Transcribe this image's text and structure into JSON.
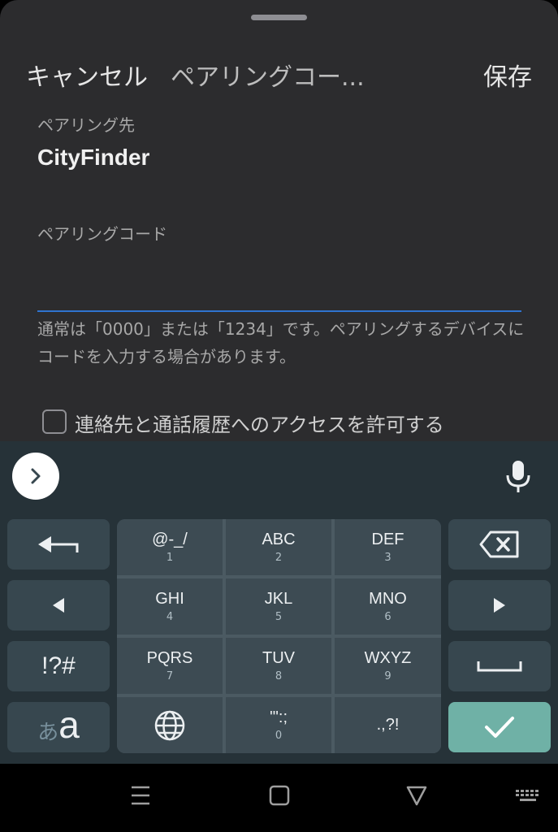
{
  "dialog": {
    "cancel_label": "キャンセル",
    "title": "ペアリングコー...",
    "save_label": "保存",
    "target_label": "ペアリング先",
    "target_value": "CityFinder",
    "code_label": "ペアリングコード",
    "code_value": "",
    "help_text": "通常は「0000」または「1234」です。ペアリングするデバイスにコードを入力する場合があります。",
    "contacts_checkbox_label": "連絡先と通話履歴へのアクセスを許可する",
    "contacts_checkbox_checked": false
  },
  "keyboard": {
    "keys": [
      {
        "main": "@-_/",
        "sub": "1"
      },
      {
        "main": "ABC",
        "sub": "2"
      },
      {
        "main": "DEF",
        "sub": "3"
      },
      {
        "main": "GHI",
        "sub": "4"
      },
      {
        "main": "JKL",
        "sub": "5"
      },
      {
        "main": "MNO",
        "sub": "6"
      },
      {
        "main": "PQRS",
        "sub": "7"
      },
      {
        "main": "TUV",
        "sub": "8"
      },
      {
        "main": "WXYZ",
        "sub": "9"
      },
      {
        "main": "'\":;",
        "sub": "0"
      },
      {
        "main": ".,?!",
        "sub": ""
      }
    ],
    "symbols_label": "!?#",
    "mode_kana": "あ",
    "mode_alpha": "a"
  },
  "colors": {
    "accent": "#2f74d0",
    "confirm": "#6fb1a6",
    "keyboard_bg": "#263238"
  }
}
